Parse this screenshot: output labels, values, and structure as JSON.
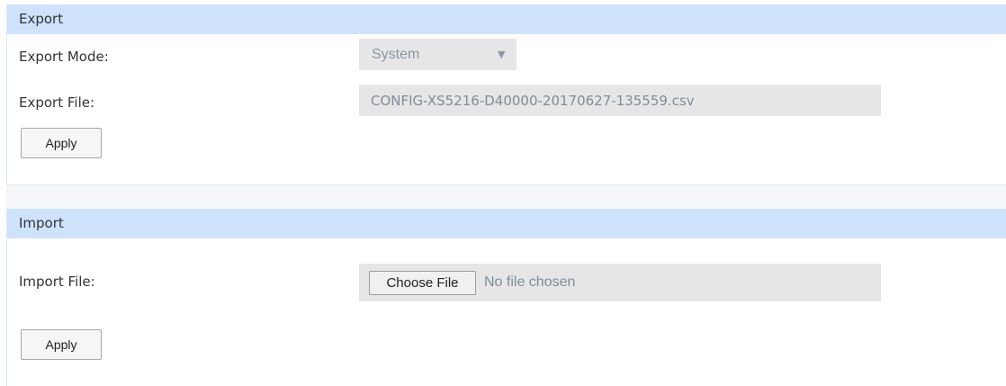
{
  "export": {
    "title": "Export",
    "mode_label": "Export Mode:",
    "mode_value": "System",
    "file_label": "Export File:",
    "file_value": "CONFIG-XS5216-D40000-20170627-135559.csv",
    "apply_label": "Apply"
  },
  "import": {
    "title": "Import",
    "file_label": "Import File:",
    "choose_label": "Choose File",
    "file_status": "No file chosen",
    "apply_label": "Apply"
  },
  "icons": {
    "select_caret": "caret-down-icon"
  },
  "colors": {
    "section_header": "#cfe2fb",
    "field_background": "#e6e6e6",
    "muted_text": "#7f8c9b",
    "label_text": "#333333"
  }
}
